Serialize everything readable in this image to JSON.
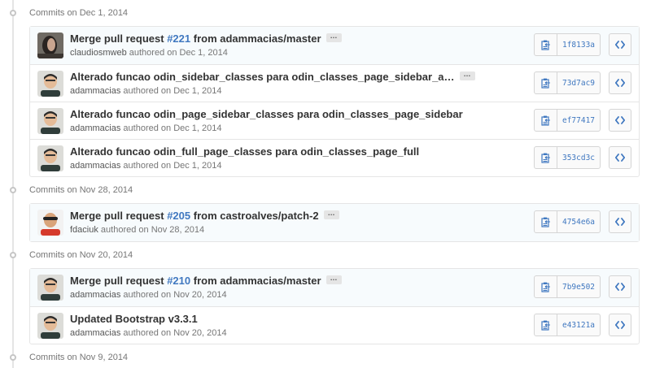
{
  "groups": [
    {
      "date_label": "Commits on Dec 1, 2014",
      "commits": [
        {
          "avatar": "claudiosmweb",
          "title_prefix": "Merge pull request ",
          "pr": "#221",
          "title_suffix": " from adammacias/master",
          "has_ellipsis": true,
          "author": "claudiosmweb",
          "authored": " authored on Dec 1, 2014",
          "sha": "1f8133a"
        },
        {
          "avatar": "adammacias",
          "title_prefix": "Alterado funcao odin_sidebar_classes para odin_classes_page_sidebar_a…",
          "pr": "",
          "title_suffix": "",
          "has_ellipsis": true,
          "author": "adammacias",
          "authored": " authored on Dec 1, 2014",
          "sha": "73d7ac9"
        },
        {
          "avatar": "adammacias",
          "title_prefix": "Alterado funcao odin_page_sidebar_classes para odin_classes_page_sidebar",
          "pr": "",
          "title_suffix": "",
          "has_ellipsis": false,
          "author": "adammacias",
          "authored": " authored on Dec 1, 2014",
          "sha": "ef77417"
        },
        {
          "avatar": "adammacias",
          "title_prefix": "Alterado funcao odin_full_page_classes para odin_classes_page_full",
          "pr": "",
          "title_suffix": "",
          "has_ellipsis": false,
          "author": "adammacias",
          "authored": " authored on Dec 1, 2014",
          "sha": "353cd3c"
        }
      ]
    },
    {
      "date_label": "Commits on Nov 28, 2014",
      "commits": [
        {
          "avatar": "fdaciuk",
          "title_prefix": "Merge pull request ",
          "pr": "#205",
          "title_suffix": " from castroalves/patch-2",
          "has_ellipsis": true,
          "author": "fdaciuk",
          "authored": " authored on Nov 28, 2014",
          "sha": "4754e6a"
        }
      ]
    },
    {
      "date_label": "Commits on Nov 20, 2014",
      "commits": [
        {
          "avatar": "adammacias",
          "title_prefix": "Merge pull request ",
          "pr": "#210",
          "title_suffix": " from adammacias/master",
          "has_ellipsis": true,
          "author": "adammacias",
          "authored": " authored on Nov 20, 2014",
          "sha": "7b9e502"
        },
        {
          "avatar": "adammacias",
          "title_prefix": "Updated Bootstrap v3.3.1",
          "pr": "",
          "title_suffix": "",
          "has_ellipsis": false,
          "author": "adammacias",
          "authored": " authored on Nov 20, 2014",
          "sha": "e43121a"
        }
      ]
    },
    {
      "date_label": "Commits on Nov 9, 2014",
      "commits": []
    }
  ],
  "icons": {
    "copy": "clipboard-icon",
    "browse": "code-icon",
    "timeline": "git-commit-icon"
  },
  "colors": {
    "link": "#4078c0",
    "muted": "#767676",
    "border": "#e5e5e5"
  }
}
